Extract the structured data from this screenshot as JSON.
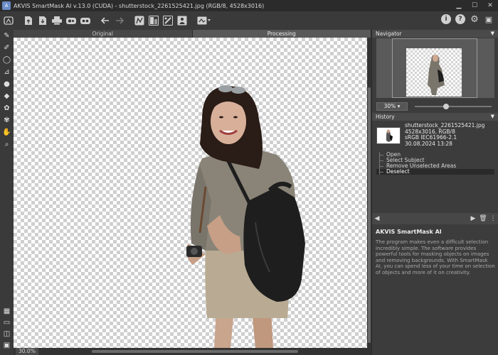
{
  "window": {
    "title": "AKVIS SmartMask AI v.13.0 (CUDA) - shutterstock_2261525421.jpg (RGB/8, 4528x3016)",
    "buttons": [
      "minimize",
      "maximize",
      "close"
    ]
  },
  "toolbar": {
    "left_icons": [
      "app-menu-icon",
      "open-icon",
      "save-icon",
      "print-icon",
      "share-icon",
      "share-alt-icon",
      "undo-icon",
      "redo-icon",
      "select-subject-icon",
      "mask-icon",
      "tool-icon",
      "image-icon",
      "layers-icon"
    ],
    "right_icons": [
      "info-icon",
      "help-icon",
      "settings-icon",
      "feedback-icon"
    ]
  },
  "tabs": [
    {
      "label": "Original",
      "active": false
    },
    {
      "label": "Processing",
      "active": true
    }
  ],
  "tools": [
    "selection-brush-icon",
    "magic-brush-icon",
    "lasso-icon",
    "dropper-icon",
    "drop-icon",
    "eraser-icon",
    "color-brush-icon",
    "color-eraser-icon",
    "hand-icon",
    "zoom-icon"
  ],
  "view_tools": [
    "checker-view-icon",
    "rect-view-icon",
    "split-view-icon",
    "mask-view-icon"
  ],
  "status": {
    "zoom": "30.0%"
  },
  "navigator": {
    "title": "Navigator",
    "zoom_value": "30%"
  },
  "history": {
    "title": "History",
    "snapshot": {
      "filename": "shutterstock_2261525421.jpg",
      "size": "4528x3016, RGB/8",
      "profile": "sRGB IEC61966-2.1",
      "date": "30.08.2024 13:28"
    },
    "items": [
      {
        "label": "Open",
        "selected": false
      },
      {
        "label": "Select Subject",
        "selected": false
      },
      {
        "label": "Remove Unselected Areas",
        "selected": false
      },
      {
        "label": "Deselect",
        "selected": true
      }
    ]
  },
  "help": {
    "title": "AKVIS SmartMask AI",
    "text": "The program makes even a difficult selection incredibly simple. The software provides powerful tools for masking objects on images and removing backgrounds. With SmartMask AI, you can spend less of your time on selection of objects and more of it on creativity."
  }
}
